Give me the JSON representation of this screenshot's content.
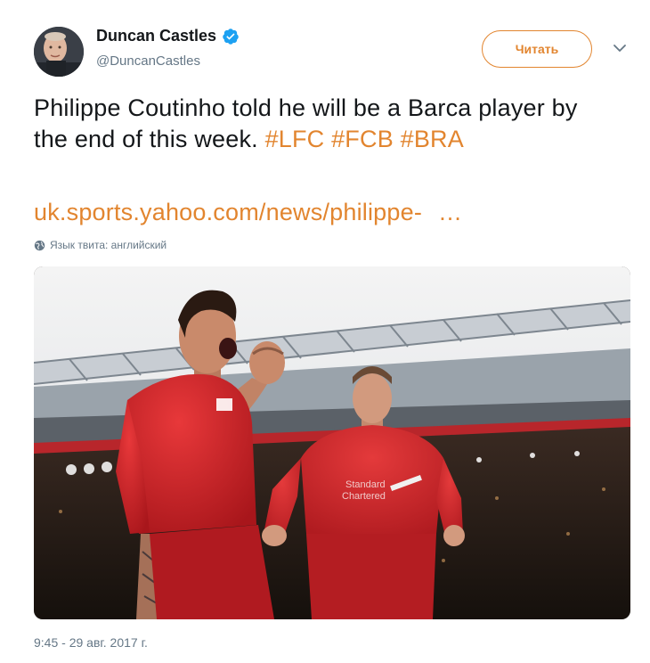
{
  "author": {
    "display_name": "Duncan Castles",
    "handle": "@DuncanCastles",
    "verified": true,
    "avatar_icon": "avatar-photo"
  },
  "follow_button": {
    "label": "Читать",
    "color": "#e2852f"
  },
  "menu_icon": "chevron-down-icon",
  "tweet": {
    "text": "Philippe Coutinho told he will be a Barca player by the end of this week.",
    "hashtags": [
      "#LFC",
      "#FCB",
      "#BRA"
    ],
    "link_text": "uk.sports.yahoo.com/news/philippe-",
    "link_ellipsis": "…",
    "language_note": "Язык твита: английский",
    "timestamp": "9:45 - 29 авг. 2017 г."
  },
  "media": {
    "type": "photo",
    "description_icon": "football-celebration-photo",
    "shirt_text": [
      "Standard",
      "Chartered"
    ]
  },
  "colors": {
    "accent": "#e2852f",
    "text": "#14171a",
    "secondary": "#657786",
    "verified": "#1da1f2"
  }
}
